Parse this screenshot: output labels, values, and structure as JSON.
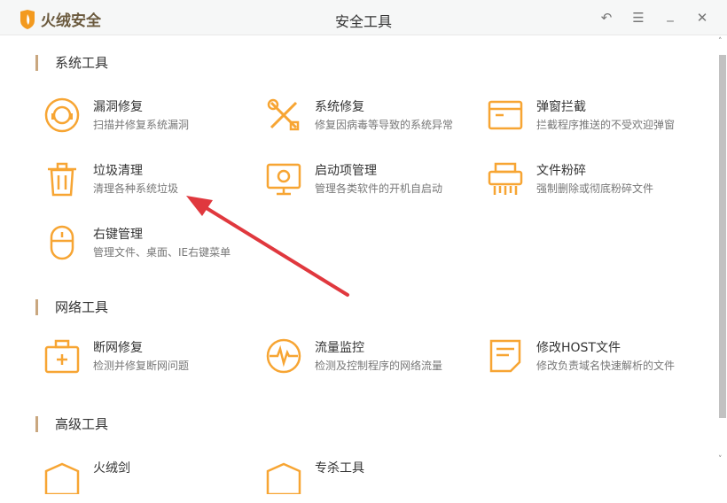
{
  "app": {
    "name": "火绒安全",
    "title": "安全工具",
    "accent": "#f7a533"
  },
  "window_buttons": [
    {
      "name": "back",
      "glyph": "↶"
    },
    {
      "name": "menu",
      "glyph": "☰"
    },
    {
      "name": "minimize",
      "glyph": "_"
    },
    {
      "name": "close",
      "glyph": "✕"
    }
  ],
  "sections": [
    {
      "title": "系统工具",
      "tools": [
        {
          "name": "漏洞修复",
          "desc": "扫描并修复系统漏洞",
          "icon": "shield-repair-icon"
        },
        {
          "name": "系统修复",
          "desc": "修复因病毒等导致的系统异常",
          "icon": "wrench-screwdriver-icon"
        },
        {
          "name": "弹窗拦截",
          "desc": "拦截程序推送的不受欢迎弹窗",
          "icon": "popup-window-icon"
        },
        {
          "name": "垃圾清理",
          "desc": "清理各种系统垃圾",
          "icon": "trash-icon"
        },
        {
          "name": "启动项管理",
          "desc": "管理各类软件的开机自启动",
          "icon": "monitor-power-icon"
        },
        {
          "name": "文件粉碎",
          "desc": "强制删除或彻底粉碎文件",
          "icon": "shredder-icon"
        },
        {
          "name": "右键管理",
          "desc": "管理文件、桌面、IE右键菜单",
          "icon": "mouse-icon"
        }
      ]
    },
    {
      "title": "网络工具",
      "tools": [
        {
          "name": "断网修复",
          "desc": "检测并修复断网问题",
          "icon": "first-aid-kit-icon"
        },
        {
          "name": "流量监控",
          "desc": "检测及控制程序的网络流量",
          "icon": "pulse-icon"
        },
        {
          "name": "修改HOST文件",
          "desc": "修改负责域名快速解析的文件",
          "icon": "document-icon"
        }
      ]
    },
    {
      "title": "高级工具",
      "tools": [
        {
          "name": "火绒剑",
          "desc": "",
          "icon": "sword-icon"
        },
        {
          "name": "专杀工具",
          "desc": "",
          "icon": "kill-tool-icon"
        }
      ]
    }
  ]
}
